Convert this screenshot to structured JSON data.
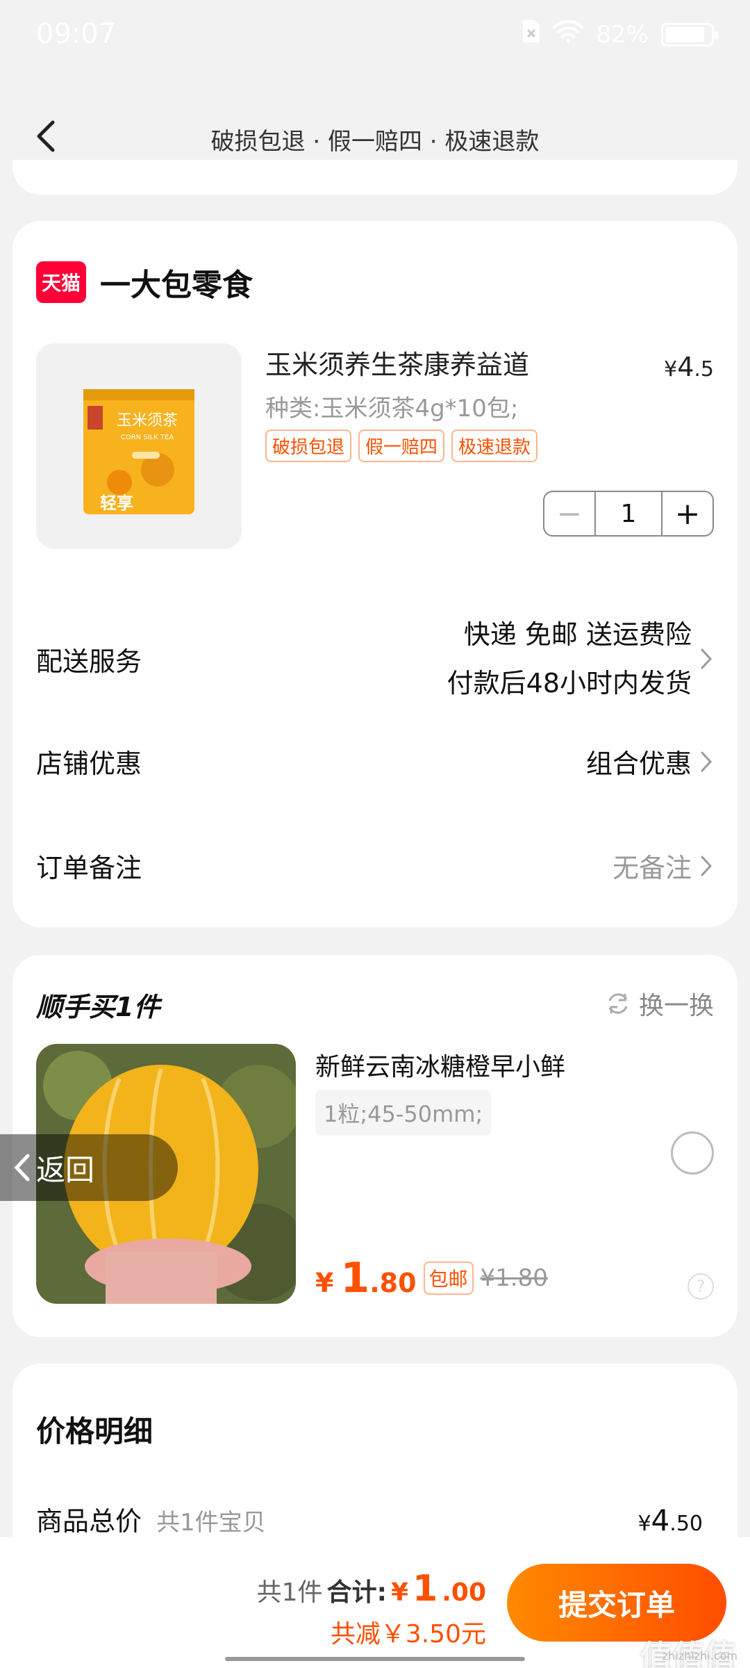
{
  "status_bar": {
    "time": "09:07",
    "battery": "82%"
  },
  "header": {
    "title": "破损包退 · 假一赔四 · 极速退款"
  },
  "shop": {
    "logo_text": "天猫",
    "name": "一大包零食",
    "product": {
      "name": "玉米须养生茶康养益道",
      "price_symbol": "¥",
      "price_int": "4",
      "price_dec": ".5",
      "spec": "种类:玉米须茶4g*10包;",
      "tags": [
        "破损包退",
        "假一赔四",
        "极速退款"
      ],
      "quantity": "1",
      "package_text": "玉米须茶",
      "package_sub": "CORN SILK TEA",
      "package_brand": "轻享"
    },
    "delivery": {
      "label": "配送服务",
      "line1": "快递 免邮 送运费险",
      "line2": "付款后48小时内发货"
    },
    "discount": {
      "label": "店铺优惠",
      "value": "组合优惠"
    },
    "note": {
      "label": "订单备注",
      "value": "无备注"
    }
  },
  "addon": {
    "title": "顺手买1件",
    "swap_label": "换一换",
    "name": "新鲜云南冰糖橙早小鲜",
    "spec": "1粒;45-50mm;",
    "price_symbol": "¥",
    "price_int": "1",
    "price_dec": ".80",
    "free_ship": "包邮",
    "old_price": "¥1.80",
    "help": "?"
  },
  "return_pill": {
    "label": "返回"
  },
  "price_detail": {
    "title": "价格明细",
    "total_label": "商品总价",
    "total_sub": "共1件宝贝",
    "total_symbol": "¥",
    "total_int": "4",
    "total_dec": ".50"
  },
  "bottom": {
    "count": "共1件",
    "sum_label": "合计:",
    "sum_symbol": "¥",
    "sum_int": "1",
    "sum_dec": ".00",
    "saving": "共减￥3.50元",
    "submit": "提交订单",
    "watermark": "值值值",
    "watermark_url": "zhizhizhi.com"
  },
  "colors": {
    "accent": "#ff5000",
    "tmall": "#ff0036",
    "bg": "#f2f2f2"
  }
}
